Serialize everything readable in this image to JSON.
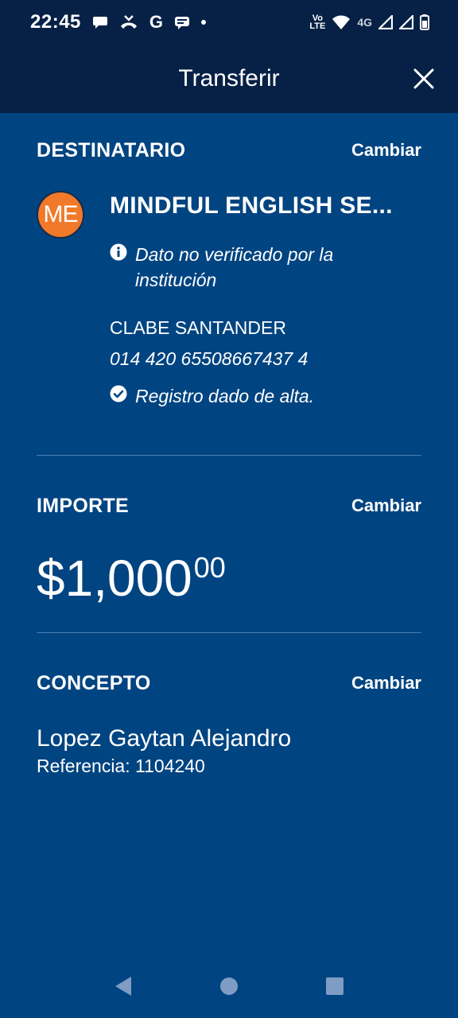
{
  "status_bar": {
    "time": "22:45",
    "left_icons": [
      "chat-bubble-icon",
      "missed-call-icon",
      "google-g-icon",
      "message-icon",
      "dot-icon"
    ],
    "google_letter": "G",
    "volte_top": "Vo",
    "volte_bottom": "LTE",
    "network": "4G",
    "right_icons": [
      "volte-icon",
      "wifi-icon",
      "signal-icon",
      "signal-icon",
      "battery-icon"
    ]
  },
  "header": {
    "title": "Transferir",
    "close_icon": "close-icon"
  },
  "recipient": {
    "section_title": "DESTINATARIO",
    "change_label": "Cambiar",
    "avatar_initials": "ME",
    "name": "MINDFUL ENGLISH SE...",
    "warning_text": "Dato no verificado por la institución",
    "account_type": "CLABE SANTANDER",
    "account_number": "014 420 65508667437 4",
    "registered_text": "Registro dado de alta."
  },
  "amount": {
    "section_title": "IMPORTE",
    "change_label": "Cambiar",
    "integer": "$1,000",
    "decimals": "00"
  },
  "concept": {
    "section_title": "CONCEPTO",
    "change_label": "Cambiar",
    "text": "Lopez Gaytan Alejandro",
    "reference": "Referencia: 1104240"
  },
  "colors": {
    "background": "#004481",
    "header": "#072146",
    "avatar": "#f07a2a",
    "divider": "#4a7fb3",
    "nav_icons": "#7f9cc4"
  },
  "nav_bar": {
    "icons": [
      "back-icon",
      "home-icon",
      "recents-icon"
    ]
  }
}
